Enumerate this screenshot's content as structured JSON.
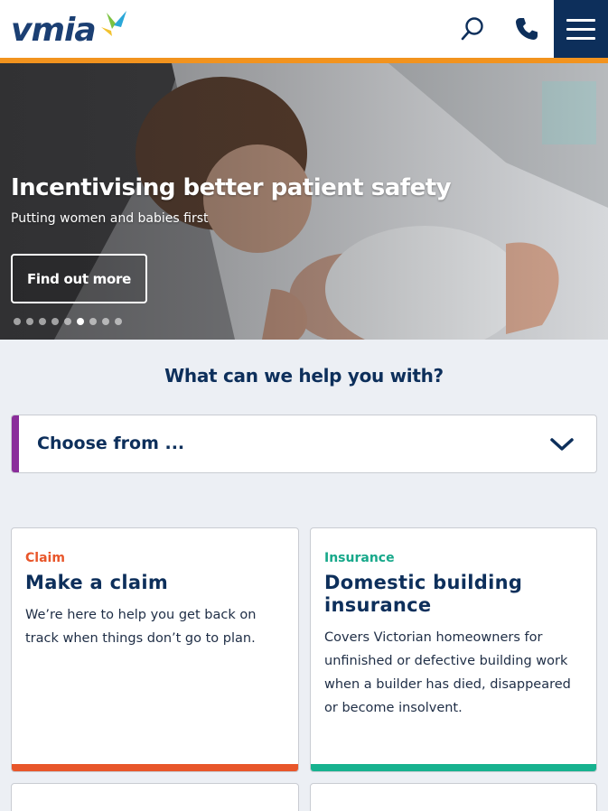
{
  "header": {
    "logo_text": "vmia",
    "search_icon": "search-icon",
    "phone_icon": "phone-icon",
    "menu_icon": "hamburger-menu-icon"
  },
  "colors": {
    "brand_navy": "#0d2f5b",
    "accent_orange": "#f2931e",
    "claim_orange": "#e8562a",
    "insurance_green": "#17b28f",
    "select_accent_purple": "#8a2d9a",
    "logo_green": "#7cc242",
    "logo_blue": "#2aa7d8"
  },
  "hero": {
    "title": "Incentivising better patient safety",
    "subtitle": "Putting women and babies first",
    "cta_label": "Find out more",
    "slides_total": 9,
    "active_slide": 6
  },
  "help": {
    "title": "What can we help you with?",
    "select_value": "Choose from ..."
  },
  "cards": [
    {
      "category": "Claim",
      "title": "Make a claim",
      "description": "We’re here to help you get back on track when things don’t go to plan."
    },
    {
      "category": "Insurance",
      "title": "Domestic building insurance",
      "description": "Covers Victorian homeowners for unfinished or defective building work when a builder has died, disappeared or become insolvent."
    }
  ]
}
